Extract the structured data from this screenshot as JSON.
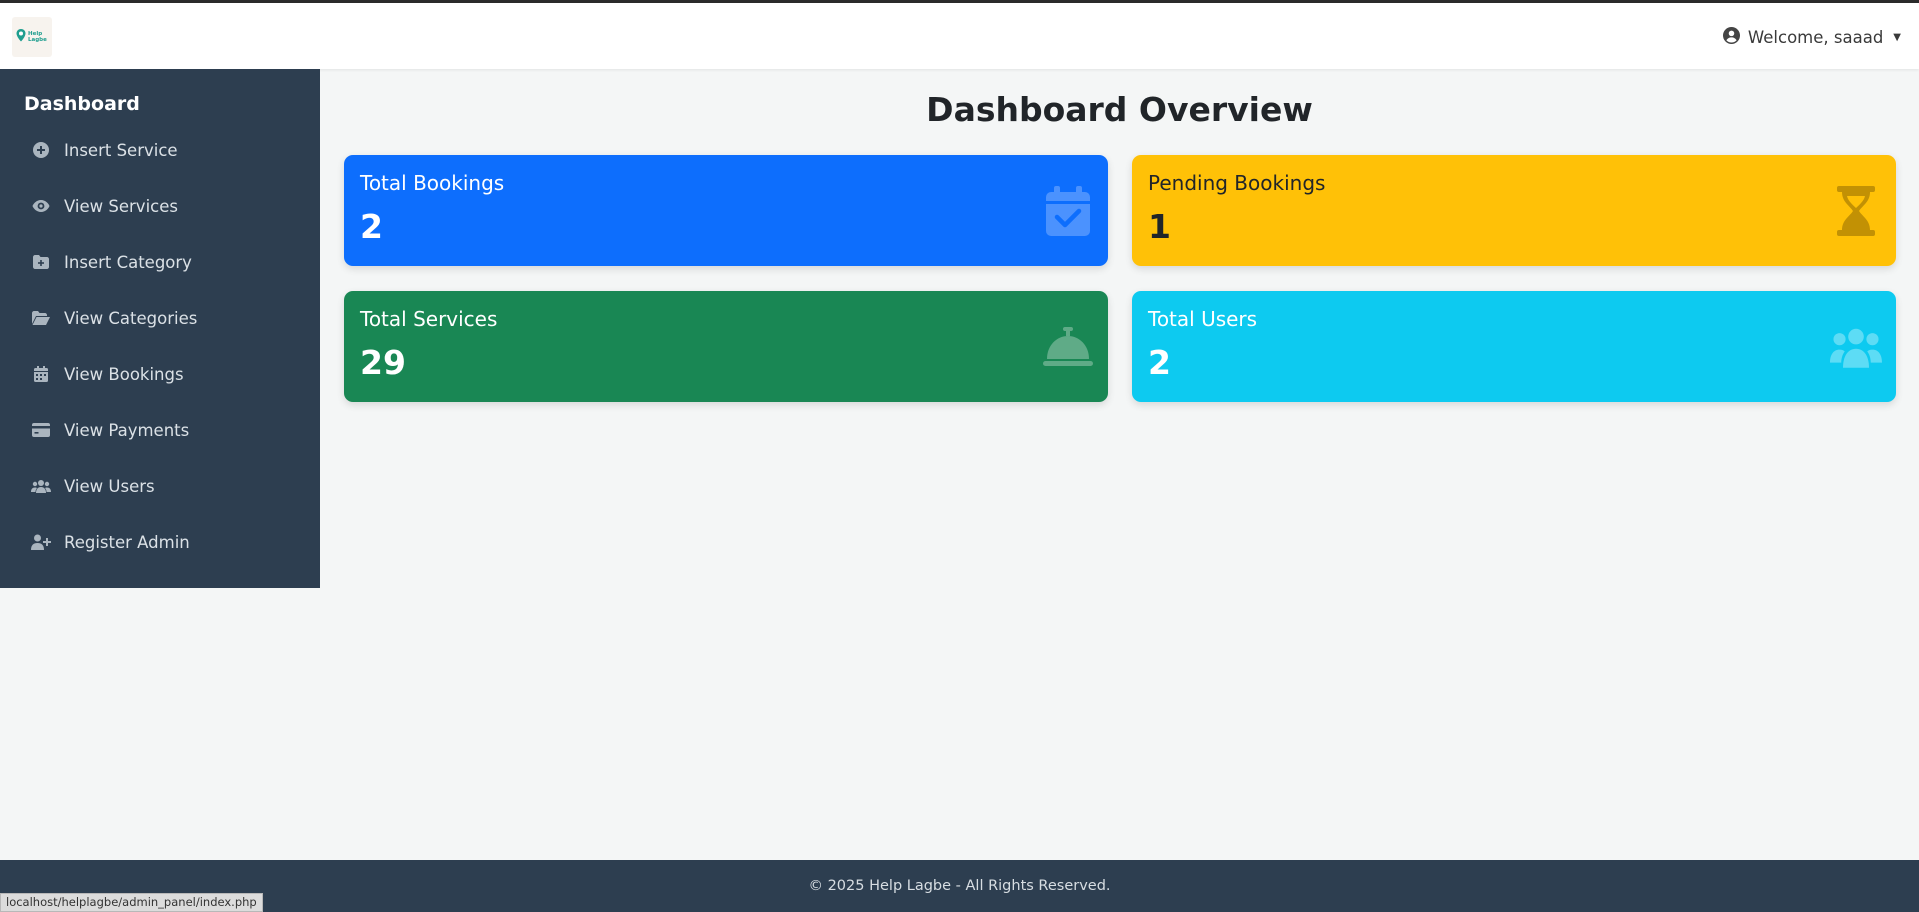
{
  "navbar": {
    "logo_text": "Help Lagbe",
    "welcome": "Welcome, saaad"
  },
  "sidebar": {
    "title": "Dashboard",
    "items": [
      {
        "label": "Insert Service",
        "icon": "plus-circle-icon"
      },
      {
        "label": "View Services",
        "icon": "eye-icon"
      },
      {
        "label": "Insert Category",
        "icon": "folder-plus-icon"
      },
      {
        "label": "View Categories",
        "icon": "folder-open-icon"
      },
      {
        "label": "View Bookings",
        "icon": "calendar-icon"
      },
      {
        "label": "View Payments",
        "icon": "credit-card-icon"
      },
      {
        "label": "View Users",
        "icon": "users-icon"
      },
      {
        "label": "Register Admin",
        "icon": "user-plus-icon"
      }
    ]
  },
  "main": {
    "title": "Dashboard Overview",
    "cards": [
      {
        "title": "Total Bookings",
        "value": "2",
        "icon": "calendar-check-icon",
        "color": "#0d6efd"
      },
      {
        "title": "Pending Bookings",
        "value": "1",
        "icon": "hourglass-icon",
        "color": "#ffc107"
      },
      {
        "title": "Total Services",
        "value": "29",
        "icon": "concierge-bell-icon",
        "color": "#198754"
      },
      {
        "title": "Total Users",
        "value": "2",
        "icon": "users-icon",
        "color": "#0dcaf0"
      }
    ]
  },
  "footer": {
    "text": "© 2025 Help Lagbe - All Rights Reserved."
  },
  "status_bar": {
    "url": "localhost/helplagbe/admin_panel/index.php"
  },
  "colors": {
    "sidebar_bg": "#2d3e50",
    "page_bg": "#f4f6f6",
    "footer_bg": "#2d3e50"
  }
}
